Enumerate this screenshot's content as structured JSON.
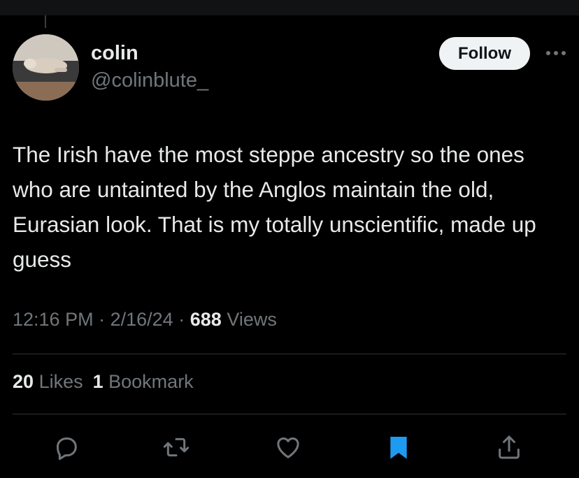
{
  "tweet": {
    "author": {
      "name": "colin",
      "handle": "@colinblute_"
    },
    "follow_label": "Follow",
    "text": "The Irish have the most steppe ancestry so the ones who are untainted by the Anglos maintain the old, Eurasian look. That is my totally unscientific, made up guess",
    "time": "12:16 PM",
    "date": "2/16/24",
    "separator": "·",
    "views_count": "688",
    "views_label": "Views",
    "likes_count": "20",
    "likes_label": "Likes",
    "bookmarks_count": "1",
    "bookmarks_label": "Bookmark"
  },
  "actions": [
    {
      "icon": "reply-icon"
    },
    {
      "icon": "retweet-icon"
    },
    {
      "icon": "like-icon"
    },
    {
      "icon": "bookmark-icon",
      "active": true,
      "color": "#1d9bf0"
    },
    {
      "icon": "share-icon"
    }
  ],
  "colors": {
    "background": "#000000",
    "primary_text": "#e7e9ea",
    "secondary_text": "#71767b",
    "divider": "#2f3336",
    "accent": "#1d9bf0"
  }
}
